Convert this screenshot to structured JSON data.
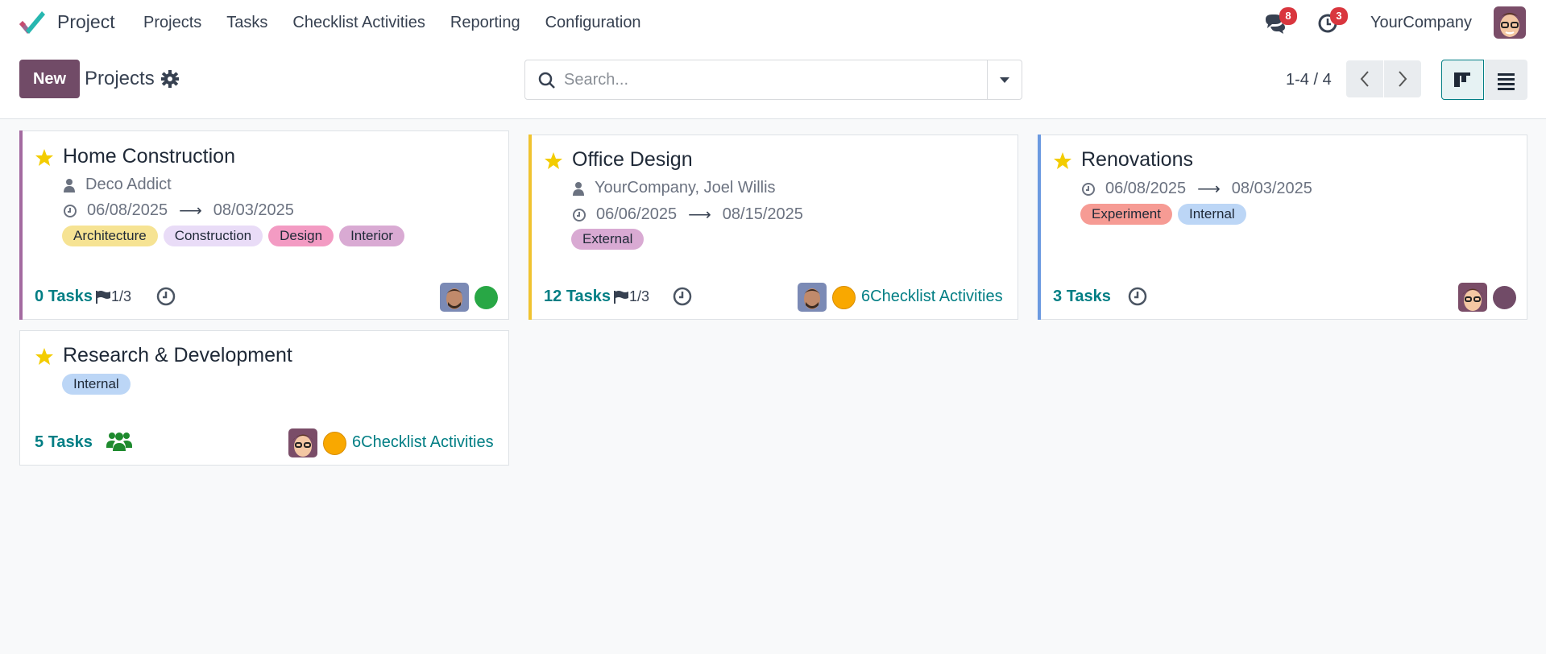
{
  "nav": {
    "app_name": "Project",
    "menu": [
      "Projects",
      "Tasks",
      "Checklist Activities",
      "Reporting",
      "Configuration"
    ],
    "messages_badge": "8",
    "activities_badge": "3",
    "company": "YourCompany"
  },
  "control": {
    "new_label": "New",
    "title": "Projects",
    "search_placeholder": "Search...",
    "pager": "1-4 / 4"
  },
  "colors": {
    "brand": "#714b67",
    "link": "#017e84",
    "star": "#f3cc00",
    "green_status": "#28a745",
    "orange_status": "#f9a800",
    "purple_status": "#714b67"
  },
  "cards": [
    {
      "title": "Home Construction",
      "customer": "Deco Addict",
      "date_start": "06/08/2025",
      "date_end": "08/03/2025",
      "tags": [
        "Architecture",
        "Construction",
        "Design",
        "Interior"
      ],
      "tasks_count": "0",
      "tasks_label": "Tasks",
      "milestones": "1/3",
      "status": "green",
      "accent": "#a36aa0"
    },
    {
      "title": "Office Design",
      "customer": "YourCompany, Joel Willis",
      "date_start": "06/06/2025",
      "date_end": "08/15/2025",
      "tags": [
        "External"
      ],
      "tasks_count": "12",
      "tasks_label": "Tasks",
      "milestones": "1/3",
      "status": "orange",
      "activities": "6Checklist Activities",
      "accent": "#f0c330"
    },
    {
      "title": "Renovations",
      "date_start": "06/08/2025",
      "date_end": "08/03/2025",
      "tags": [
        "Experiment",
        "Internal"
      ],
      "tasks_count": "3",
      "tasks_label": "Tasks",
      "status": "purple",
      "accent": "#6c9ae0"
    },
    {
      "title": "Research & Development",
      "tags": [
        "Internal"
      ],
      "tasks_count": "5",
      "tasks_label": "Tasks",
      "status": "orange",
      "activities": "6Checklist Activities"
    }
  ]
}
